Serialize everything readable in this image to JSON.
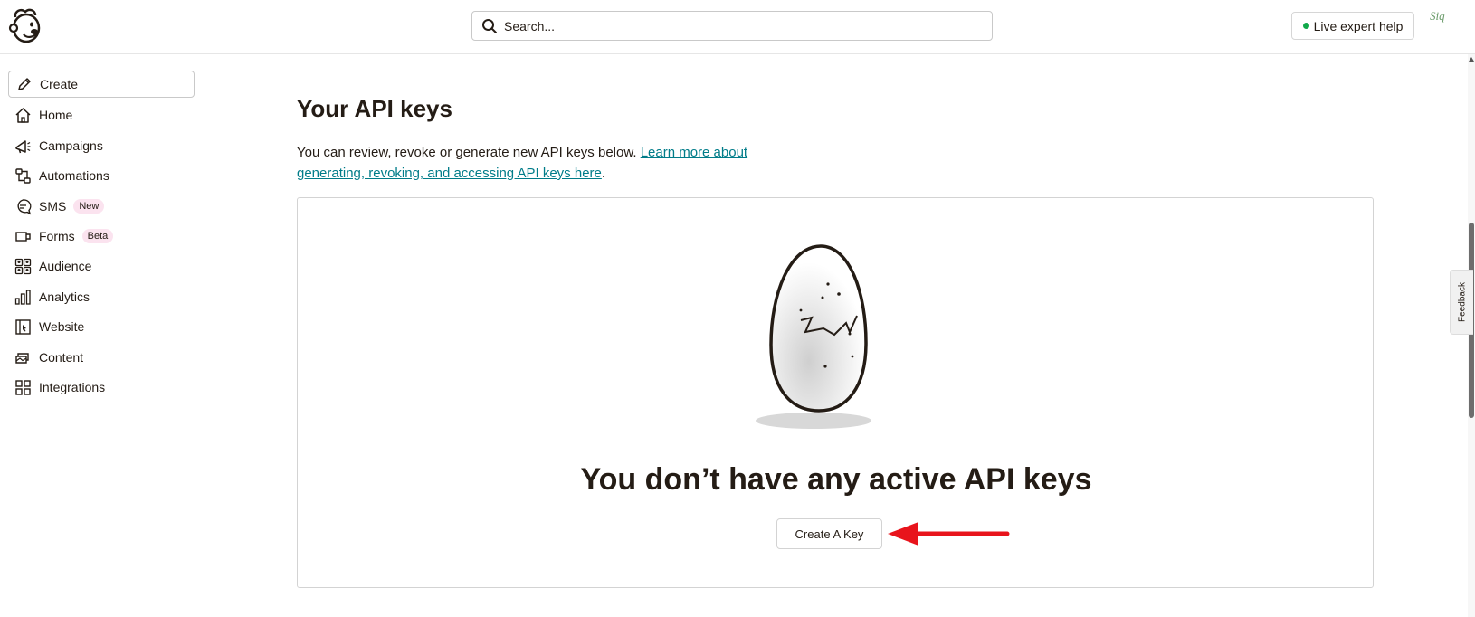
{
  "header": {
    "search_placeholder": "Search...",
    "live_help_label": "Live expert help",
    "account_logo_text": "Siq"
  },
  "sidebar": {
    "create_label": "Create",
    "items": [
      {
        "label": "Home",
        "icon": "home-icon"
      },
      {
        "label": "Campaigns",
        "icon": "megaphone-icon"
      },
      {
        "label": "Automations",
        "icon": "automation-flow-icon"
      },
      {
        "label": "SMS",
        "icon": "chat-bubble-icon",
        "badge": "New"
      },
      {
        "label": "Forms",
        "icon": "form-icon",
        "badge": "Beta"
      },
      {
        "label": "Audience",
        "icon": "audience-icon"
      },
      {
        "label": "Analytics",
        "icon": "bar-chart-icon"
      },
      {
        "label": "Website",
        "icon": "website-icon"
      },
      {
        "label": "Content",
        "icon": "content-icon"
      },
      {
        "label": "Integrations",
        "icon": "grid-icon"
      }
    ]
  },
  "main": {
    "title": "Your API keys",
    "description": "You can review, revoke or generate new API keys below.",
    "learn_more_link": "Learn more about generating, revoking, and accessing API keys here",
    "description_end": ".",
    "empty_state_title": "You don’t have any active API keys",
    "create_key_label": "Create A Key"
  },
  "feedback_label": "Feedback",
  "colors": {
    "link": "#007c89",
    "badge_bg": "#fbe3ef",
    "live_dot": "#11a94a",
    "arrow": "#e8141c"
  }
}
